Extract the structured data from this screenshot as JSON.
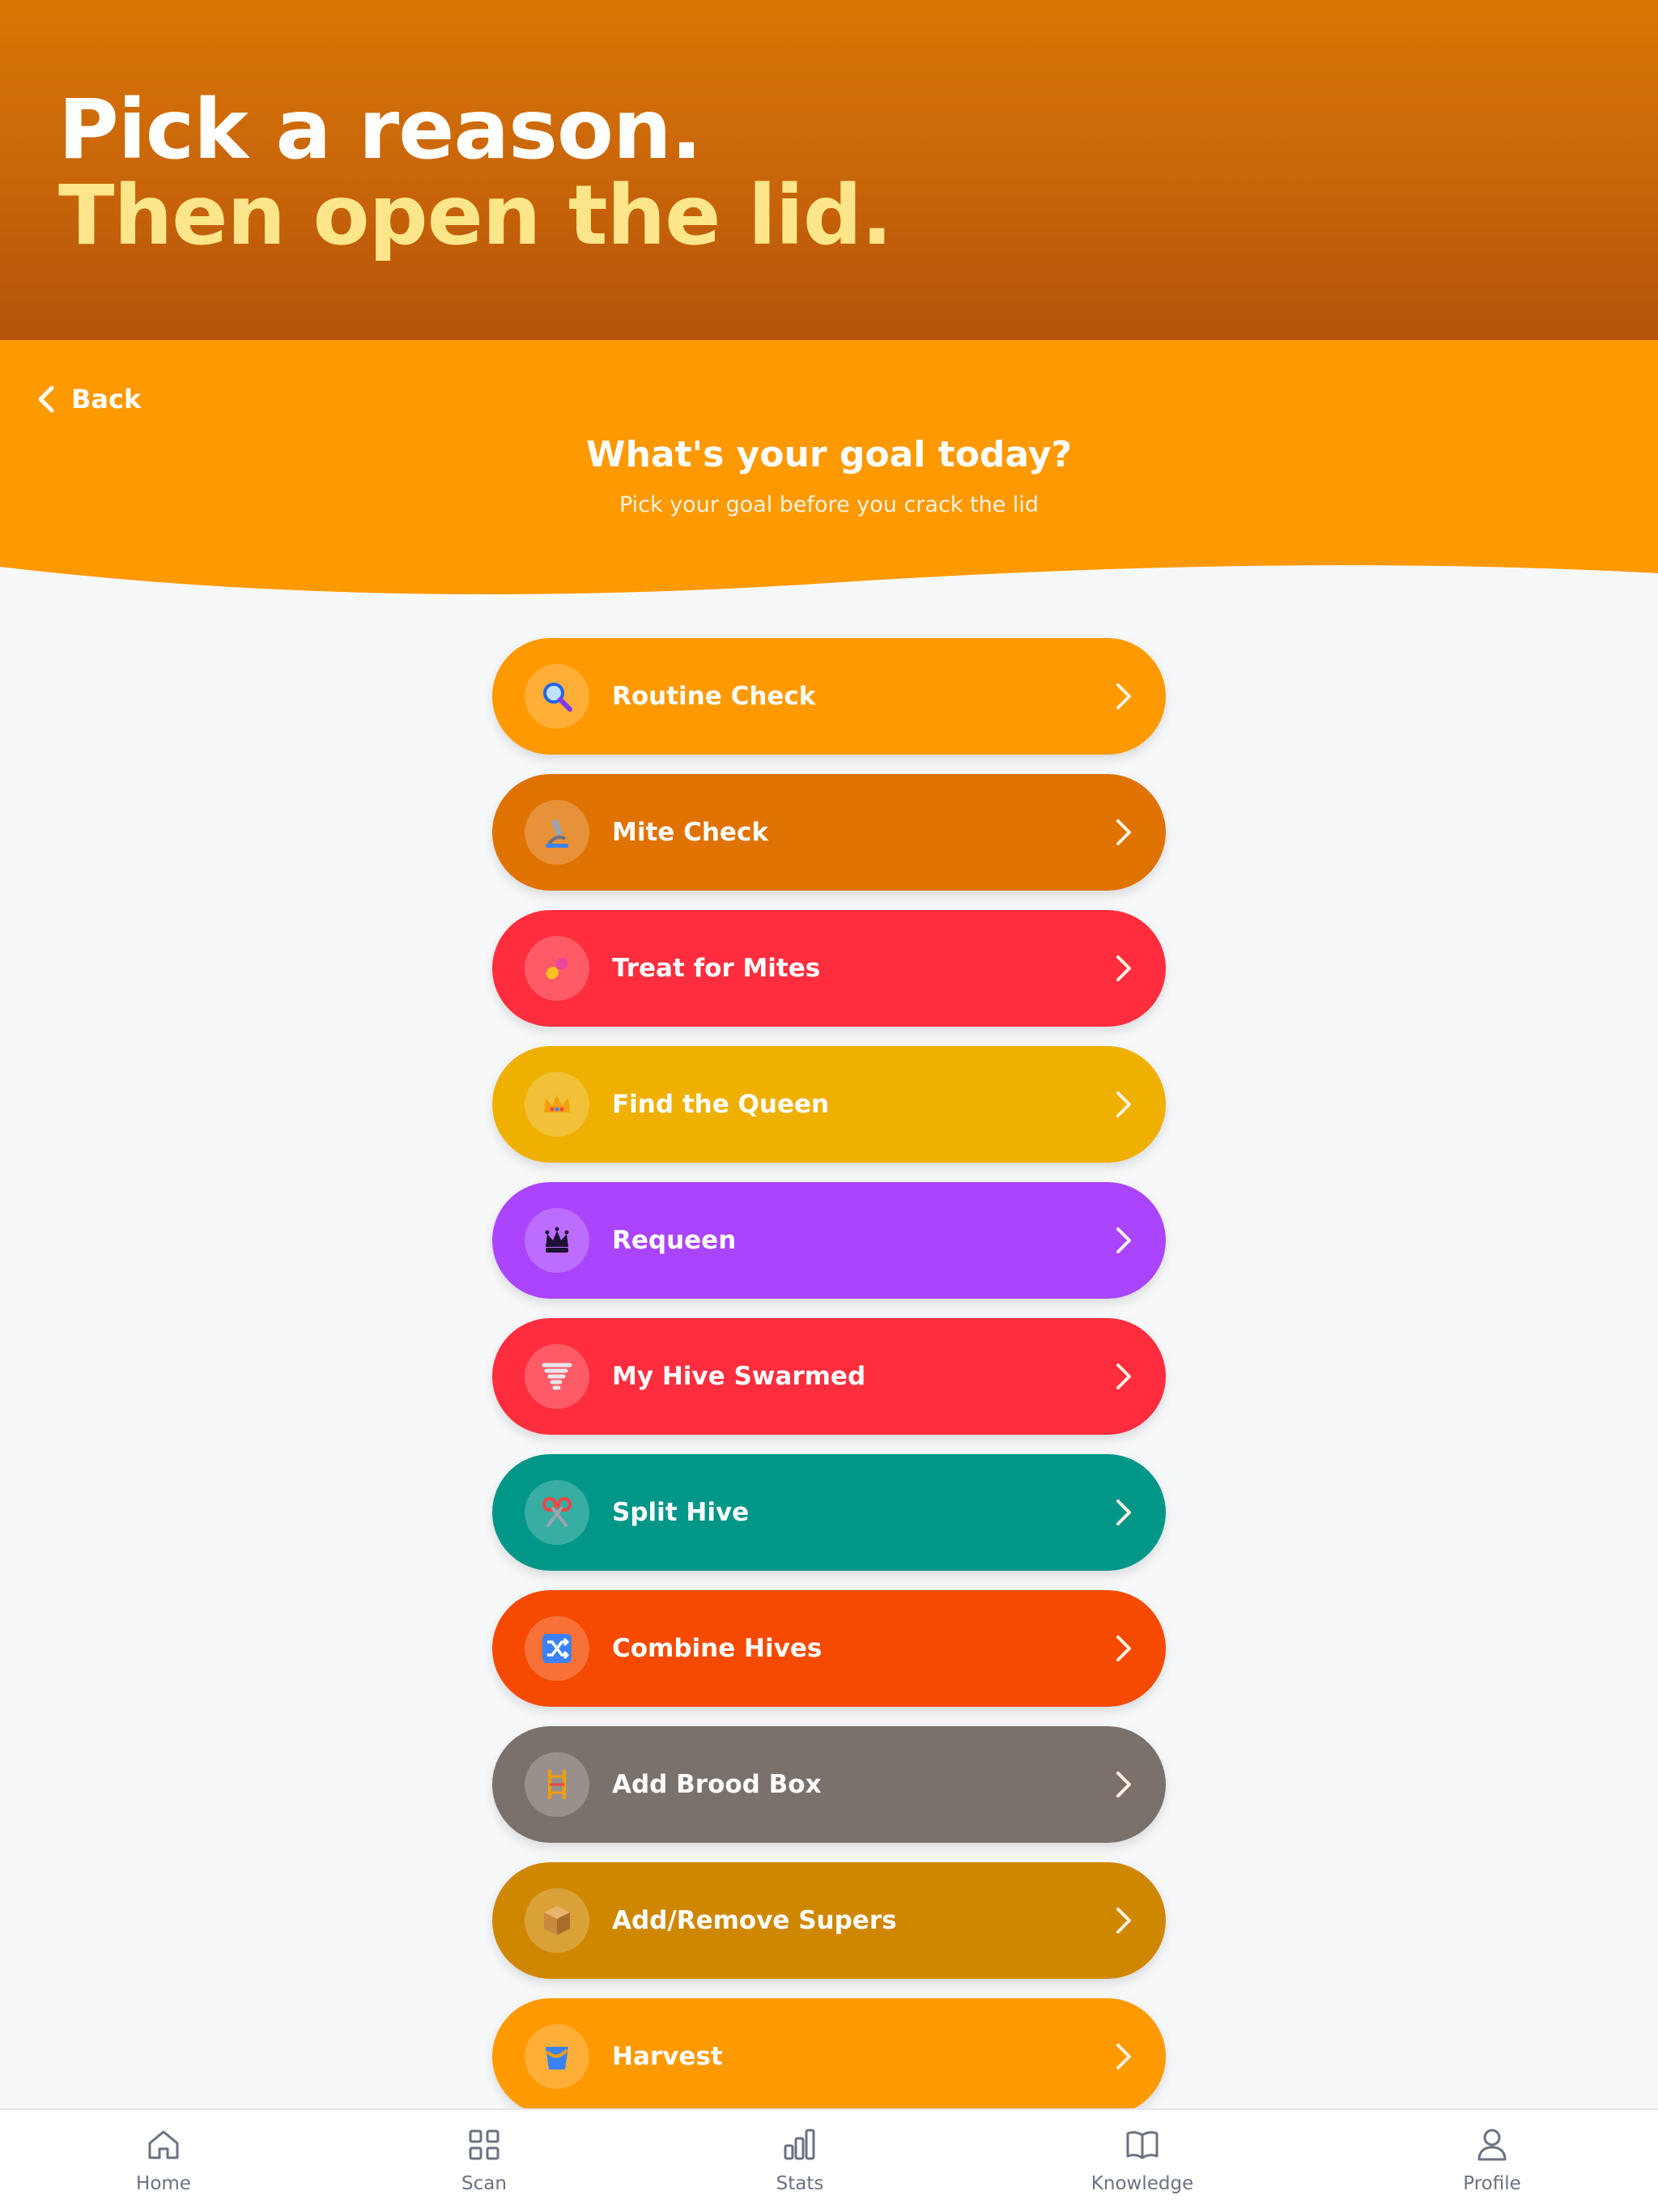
{
  "hero": {
    "line1": "Pick a reason.",
    "line2": "Then open the lid."
  },
  "header": {
    "back_label": "Back",
    "title": "What's your goal today?",
    "subtitle": "Pick your goal before you crack the lid"
  },
  "goals": [
    {
      "label": "Routine Check",
      "color": "#ff9900",
      "icon": "magnifier-icon"
    },
    {
      "label": "Mite Check",
      "color": "#e07200",
      "icon": "microscope-icon"
    },
    {
      "label": "Treat for Mites",
      "color": "#ff2d3d",
      "icon": "pill-icon"
    },
    {
      "label": "Find the Queen",
      "color": "#efb000",
      "icon": "crown-icon"
    },
    {
      "label": "Requeen",
      "color": "#aa44ff",
      "icon": "queen-chess-icon"
    },
    {
      "label": "My Hive Swarmed",
      "color": "#ff2d3d",
      "icon": "tornado-icon"
    },
    {
      "label": "Split Hive",
      "color": "#009688",
      "icon": "scissors-icon"
    },
    {
      "label": "Combine Hives",
      "color": "#f54a00",
      "icon": "shuffle-icon"
    },
    {
      "label": "Add Brood Box",
      "color": "#7a716b",
      "icon": "ladder-icon"
    },
    {
      "label": "Add/Remove Supers",
      "color": "#d08700",
      "icon": "package-icon"
    },
    {
      "label": "Harvest",
      "color": "#ff9900",
      "icon": "bucket-icon"
    }
  ],
  "nav": {
    "items": [
      {
        "label": "Home",
        "icon": "home-icon"
      },
      {
        "label": "Scan",
        "icon": "grid-icon"
      },
      {
        "label": "Stats",
        "icon": "bar-chart-icon"
      },
      {
        "label": "Knowledge",
        "icon": "book-icon"
      },
      {
        "label": "Profile",
        "icon": "user-icon"
      }
    ]
  }
}
